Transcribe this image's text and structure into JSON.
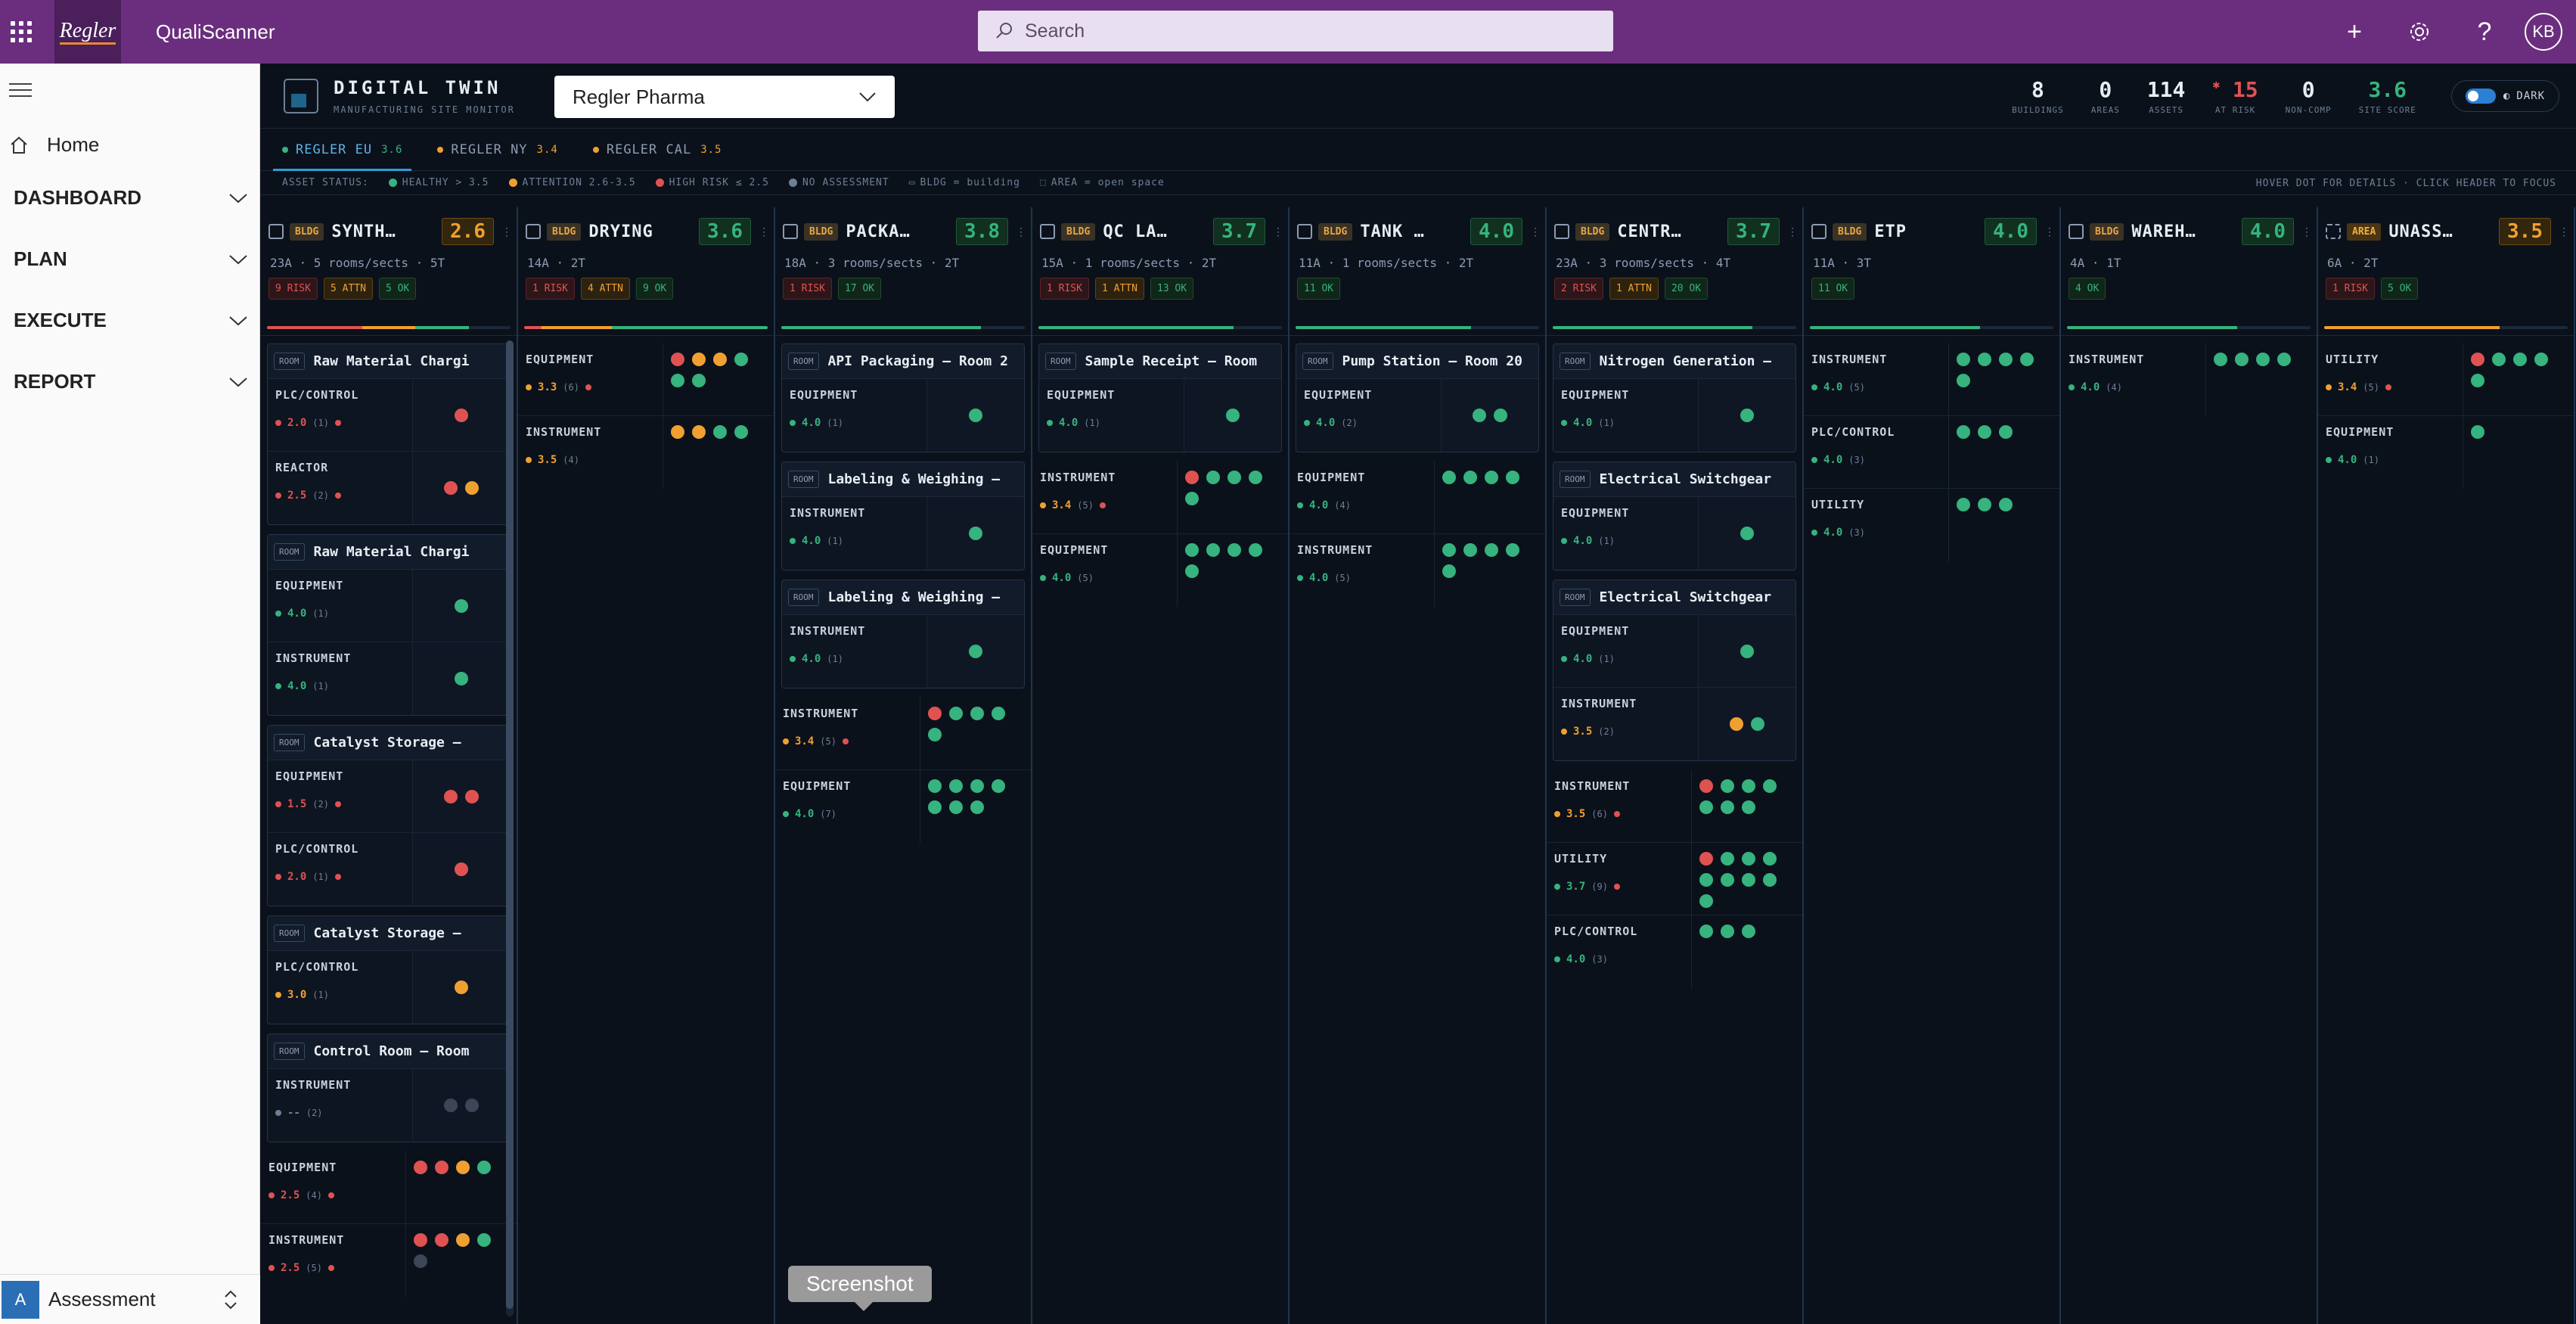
{
  "app": {
    "name": "QualiScanner",
    "logo_text": "Regler",
    "search_placeholder": "Search",
    "user_initials": "KB"
  },
  "nav": {
    "home": "Home",
    "groups": [
      "DASHBOARD",
      "PLAN",
      "EXECUTE",
      "REPORT"
    ],
    "bottom_badge": "A",
    "bottom_label": "Assessment"
  },
  "header": {
    "title": "DIGITAL TWIN",
    "subtitle": "MANUFACTURING SITE MONITOR",
    "site": "Regler Pharma",
    "stats": [
      {
        "value": "8",
        "label": "BUILDINGS"
      },
      {
        "value": "0",
        "label": "AREAS"
      },
      {
        "value": "114",
        "label": "ASSETS"
      },
      {
        "value": "15",
        "label": "AT RISK"
      },
      {
        "value": "0",
        "label": "NON-COMP"
      },
      {
        "value": "3.6",
        "label": "SITE SCORE"
      }
    ],
    "theme": "DARK"
  },
  "tabs": [
    {
      "label": "REGLER EU",
      "score": "3.6",
      "color": "#36b37e"
    },
    {
      "label": "REGLER NY",
      "score": "3.4",
      "color": "#f0a030"
    },
    {
      "label": "REGLER CAL",
      "score": "3.5",
      "color": "#f0a030"
    }
  ],
  "legend": {
    "title": "ASSET STATUS:",
    "items": [
      {
        "label": "HEALTHY > 3.5",
        "color": "#36b37e"
      },
      {
        "label": "ATTENTION 2.6-3.5",
        "color": "#f0a030"
      },
      {
        "label": "HIGH RISK ≤ 2.5",
        "color": "#e05252"
      },
      {
        "label": "NO ASSESSMENT",
        "color": "#6d7f95"
      }
    ],
    "bldg_hint": "BLDG = building",
    "area_hint": "AREA = open space",
    "help": "HOVER DOT FOR DETAILS · CLICK HEADER TO FOCUS"
  },
  "colors": {
    "healthy": "#36b37e",
    "attention": "#f0a030",
    "risk": "#e05252",
    "none": "#3c4656"
  },
  "columns": [
    {
      "type": "BLDG",
      "name": "SYNTH…",
      "score": "2.6",
      "score_level": "o",
      "meta": "23A · 5 rooms/sects · 5T",
      "chips": [
        {
          "t": "9 RISK",
          "c": "r"
        },
        {
          "t": "5 ATTN",
          "c": "o"
        },
        {
          "t": "5 OK",
          "c": "g"
        }
      ],
      "progress": {
        "r": 0.39,
        "o": 0.22,
        "g": 0.22
      },
      "rooms": [
        {
          "name": "Raw Material Chargi",
          "cats": [
            {
              "name": "PLC/CONTROL",
              "score": "2.0",
              "count": "(1)",
              "level": "r",
              "risk": true,
              "dots": "r"
            },
            {
              "name": "REACTOR",
              "score": "2.5",
              "count": "(2)",
              "level": "r",
              "risk": true,
              "dots": "ro"
            }
          ]
        },
        {
          "name": "Raw Material Chargi",
          "cats": [
            {
              "name": "EQUIPMENT",
              "score": "4.0",
              "count": "(1)",
              "level": "g",
              "risk": false,
              "dots": "g"
            },
            {
              "name": "INSTRUMENT",
              "score": "4.0",
              "count": "(1)",
              "level": "g",
              "risk": false,
              "dots": "g"
            }
          ]
        },
        {
          "name": "Catalyst Storage –",
          "cats": [
            {
              "name": "EQUIPMENT",
              "score": "1.5",
              "count": "(2)",
              "level": "r",
              "risk": true,
              "dots": "rr"
            },
            {
              "name": "PLC/CONTROL",
              "score": "2.0",
              "count": "(1)",
              "level": "r",
              "risk": true,
              "dots": "r"
            }
          ]
        },
        {
          "name": "Catalyst Storage –",
          "cats": [
            {
              "name": "PLC/CONTROL",
              "score": "3.0",
              "count": "(1)",
              "level": "o",
              "risk": false,
              "dots": "o"
            }
          ]
        },
        {
          "name": "Control Room – Room",
          "cats": [
            {
              "name": "INSTRUMENT",
              "score": "--",
              "count": "(2)",
              "level": "x",
              "risk": false,
              "dots": "xx"
            }
          ]
        }
      ],
      "loose": [
        {
          "name": "EQUIPMENT",
          "score": "2.5",
          "count": "(4)",
          "level": "r",
          "risk": true,
          "dots": "rrog"
        },
        {
          "name": "INSTRUMENT",
          "score": "2.5",
          "count": "(5)",
          "level": "r",
          "risk": true,
          "dots": "rrogx"
        }
      ]
    },
    {
      "type": "BLDG",
      "name": "DRYING",
      "score": "3.6",
      "score_level": "g",
      "meta": "14A · 2T",
      "chips": [
        {
          "t": "1 RISK",
          "c": "r"
        },
        {
          "t": "4 ATTN",
          "c": "o"
        },
        {
          "t": "9 OK",
          "c": "g"
        }
      ],
      "progress": {
        "r": 0.07,
        "o": 0.29,
        "g": 0.64
      },
      "rooms": [],
      "loose": [
        {
          "name": "EQUIPMENT",
          "score": "3.3",
          "count": "(6)",
          "level": "o",
          "risk": true,
          "dots": "rooggg"
        },
        {
          "name": "INSTRUMENT",
          "score": "3.5",
          "count": "(4)",
          "level": "o",
          "risk": false,
          "dots": "oogg"
        }
      ]
    },
    {
      "type": "BLDG",
      "name": "PACKA…",
      "score": "3.8",
      "score_level": "g",
      "meta": "18A · 3 rooms/sects · 2T",
      "chips": [
        {
          "t": "1 RISK",
          "c": "r"
        },
        {
          "t": "17 OK",
          "c": "g"
        }
      ],
      "progress": {
        "r": 0.0,
        "o": 0.0,
        "g": 0.82
      },
      "rooms": [
        {
          "name": "API Packaging – Room 2",
          "cats": [
            {
              "name": "EQUIPMENT",
              "score": "4.0",
              "count": "(1)",
              "level": "g",
              "risk": false,
              "dots": "g"
            }
          ]
        },
        {
          "name": "Labeling & Weighing –",
          "cats": [
            {
              "name": "INSTRUMENT",
              "score": "4.0",
              "count": "(1)",
              "level": "g",
              "risk": false,
              "dots": "g"
            }
          ]
        },
        {
          "name": "Labeling & Weighing –",
          "cats": [
            {
              "name": "INSTRUMENT",
              "score": "4.0",
              "count": "(1)",
              "level": "g",
              "risk": false,
              "dots": "g"
            }
          ]
        }
      ],
      "loose": [
        {
          "name": "INSTRUMENT",
          "score": "3.4",
          "count": "(5)",
          "level": "o",
          "risk": true,
          "dots": "rgggg"
        },
        {
          "name": "EQUIPMENT",
          "score": "4.0",
          "count": "(7)",
          "level": "g",
          "risk": false,
          "dots": "ggggggg"
        }
      ]
    },
    {
      "type": "BLDG",
      "name": "QC LA…",
      "score": "3.7",
      "score_level": "g",
      "meta": "15A · 1 rooms/sects · 2T",
      "chips": [
        {
          "t": "1 RISK",
          "c": "r"
        },
        {
          "t": "1 ATTN",
          "c": "o"
        },
        {
          "t": "13 OK",
          "c": "g"
        }
      ],
      "progress": {
        "r": 0.0,
        "o": 0.0,
        "g": 0.8
      },
      "rooms": [
        {
          "name": "Sample Receipt – Room",
          "cats": [
            {
              "name": "EQUIPMENT",
              "score": "4.0",
              "count": "(1)",
              "level": "g",
              "risk": false,
              "dots": "g"
            }
          ]
        }
      ],
      "loose": [
        {
          "name": "INSTRUMENT",
          "score": "3.4",
          "count": "(5)",
          "level": "o",
          "risk": true,
          "dots": "rgggg"
        },
        {
          "name": "EQUIPMENT",
          "score": "4.0",
          "count": "(5)",
          "level": "g",
          "risk": false,
          "dots": "ggggg"
        }
      ]
    },
    {
      "type": "BLDG",
      "name": "TANK …",
      "score": "4.0",
      "score_level": "g",
      "meta": "11A · 1 rooms/sects · 2T",
      "chips": [
        {
          "t": "11 OK",
          "c": "g"
        }
      ],
      "progress": {
        "r": 0.0,
        "o": 0.0,
        "g": 0.72
      },
      "rooms": [
        {
          "name": "Pump Station – Room 20",
          "cats": [
            {
              "name": "EQUIPMENT",
              "score": "4.0",
              "count": "(2)",
              "level": "g",
              "risk": false,
              "dots": "gg"
            }
          ]
        }
      ],
      "loose": [
        {
          "name": "EQUIPMENT",
          "score": "4.0",
          "count": "(4)",
          "level": "g",
          "risk": false,
          "dots": "gggg"
        },
        {
          "name": "INSTRUMENT",
          "score": "4.0",
          "count": "(5)",
          "level": "g",
          "risk": false,
          "dots": "ggggg"
        }
      ]
    },
    {
      "type": "BLDG",
      "name": "CENTR…",
      "score": "3.7",
      "score_level": "g",
      "meta": "23A · 3 rooms/sects · 4T",
      "chips": [
        {
          "t": "2 RISK",
          "c": "r"
        },
        {
          "t": "1 ATTN",
          "c": "o"
        },
        {
          "t": "20 OK",
          "c": "g"
        }
      ],
      "progress": {
        "r": 0.0,
        "o": 0.0,
        "g": 0.82
      },
      "rooms": [
        {
          "name": "Nitrogen Generation –",
          "cats": [
            {
              "name": "EQUIPMENT",
              "score": "4.0",
              "count": "(1)",
              "level": "g",
              "risk": false,
              "dots": "g"
            }
          ]
        },
        {
          "name": "Electrical Switchgear",
          "cats": [
            {
              "name": "EQUIPMENT",
              "score": "4.0",
              "count": "(1)",
              "level": "g",
              "risk": false,
              "dots": "g"
            }
          ]
        },
        {
          "name": "Electrical Switchgear",
          "cats": [
            {
              "name": "EQUIPMENT",
              "score": "4.0",
              "count": "(1)",
              "level": "g",
              "risk": false,
              "dots": "g"
            },
            {
              "name": "INSTRUMENT",
              "score": "3.5",
              "count": "(2)",
              "level": "o",
              "risk": false,
              "dots": "og"
            }
          ]
        }
      ],
      "loose": [
        {
          "name": "INSTRUMENT",
          "score": "3.5",
          "count": "(6)",
          "level": "o",
          "risk": true,
          "dots": "rgggggg"
        },
        {
          "name": "UTILITY",
          "score": "3.7",
          "count": "(9)",
          "level": "g",
          "risk": true,
          "dots": "rgggggggg"
        },
        {
          "name": "PLC/CONTROL",
          "score": "4.0",
          "count": "(3)",
          "level": "g",
          "risk": false,
          "dots": "ggg"
        }
      ]
    },
    {
      "type": "BLDG",
      "name": "ETP",
      "score": "4.0",
      "score_level": "g",
      "meta": "11A · 3T",
      "chips": [
        {
          "t": "11 OK",
          "c": "g"
        }
      ],
      "progress": {
        "r": 0.0,
        "o": 0.0,
        "g": 0.7
      },
      "rooms": [],
      "loose": [
        {
          "name": "INSTRUMENT",
          "score": "4.0",
          "count": "(5)",
          "level": "g",
          "risk": false,
          "dots": "ggggg"
        },
        {
          "name": "PLC/CONTROL",
          "score": "4.0",
          "count": "(3)",
          "level": "g",
          "risk": false,
          "dots": "ggg"
        },
        {
          "name": "UTILITY",
          "score": "4.0",
          "count": "(3)",
          "level": "g",
          "risk": false,
          "dots": "ggg"
        }
      ]
    },
    {
      "type": "BLDG",
      "name": "WAREH…",
      "score": "4.0",
      "score_level": "g",
      "meta": "4A · 1T",
      "chips": [
        {
          "t": "4 OK",
          "c": "g"
        }
      ],
      "progress": {
        "r": 0.0,
        "o": 0.0,
        "g": 0.7
      },
      "rooms": [],
      "loose": [
        {
          "name": "INSTRUMENT",
          "score": "4.0",
          "count": "(4)",
          "level": "g",
          "risk": false,
          "dots": "gggg"
        }
      ]
    },
    {
      "type": "AREA",
      "name": "UNASS…",
      "score": "3.5",
      "score_level": "o",
      "meta": "6A · 2T",
      "chips": [
        {
          "t": "1 RISK",
          "c": "r"
        },
        {
          "t": "5 OK",
          "c": "g"
        }
      ],
      "progress": {
        "r": 0.0,
        "o": 0.72,
        "g": 0.0
      },
      "rooms": [],
      "loose": [
        {
          "name": "UTILITY",
          "score": "3.4",
          "count": "(5)",
          "level": "o",
          "risk": true,
          "dots": "rgggg"
        },
        {
          "name": "EQUIPMENT",
          "score": "4.0",
          "count": "(1)",
          "level": "g",
          "risk": false,
          "dots": "g"
        }
      ]
    }
  ],
  "tooltip": "Screenshot"
}
